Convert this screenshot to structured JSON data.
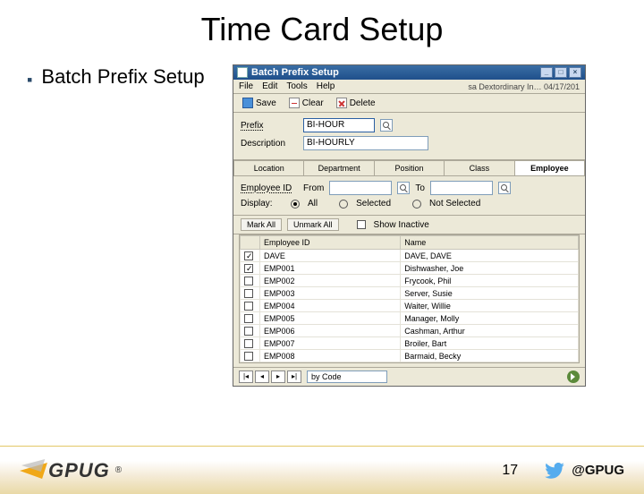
{
  "slide": {
    "title": "Time Card Setup",
    "bullet": "Batch Prefix Setup",
    "page_number": "17",
    "logo_text": "GPUG",
    "logo_reg": "®",
    "twitter_handle": "@GPUG"
  },
  "window": {
    "title": "Batch Prefix Setup",
    "status_user": "sa  Dextordinary In…  04/17/201",
    "menu": {
      "file": "File",
      "edit": "Edit",
      "tools": "Tools",
      "help": "Help"
    },
    "toolbar": {
      "save": "Save",
      "clear": "Clear",
      "delete": "Delete"
    },
    "form": {
      "prefix_label": "Prefix",
      "prefix_value": "BI-HOUR",
      "description_label": "Description",
      "description_value": "BI-HOURLY"
    },
    "tabs": {
      "location": "Location",
      "department": "Department",
      "position": "Position",
      "class": "Class",
      "employee": "Employee"
    },
    "filter": {
      "employee_id_label": "Employee ID",
      "from_label": "From",
      "to_label": "To",
      "display_label": "Display:",
      "all": "All",
      "selected": "Selected",
      "not_selected": "Not Selected"
    },
    "grid_toolbar": {
      "mark_all": "Mark All",
      "unmark_all": "Unmark All",
      "show_inactive": "Show Inactive"
    },
    "grid": {
      "col_employee": "Employee ID",
      "col_name": "Name",
      "rows": [
        {
          "checked": true,
          "id": "DAVE",
          "name": "DAVE, DAVE"
        },
        {
          "checked": true,
          "id": "EMP001",
          "name": "Dishwasher, Joe"
        },
        {
          "checked": false,
          "id": "EMP002",
          "name": "Frycook, Phil"
        },
        {
          "checked": false,
          "id": "EMP003",
          "name": "Server, Susie"
        },
        {
          "checked": false,
          "id": "EMP004",
          "name": "Waiter, Willie"
        },
        {
          "checked": false,
          "id": "EMP005",
          "name": "Manager, Molly"
        },
        {
          "checked": false,
          "id": "EMP006",
          "name": "Cashman, Arthur"
        },
        {
          "checked": false,
          "id": "EMP007",
          "name": "Broiler, Bart"
        },
        {
          "checked": false,
          "id": "EMP008",
          "name": "Barmaid, Becky"
        }
      ]
    },
    "footer": {
      "sort": "by Code"
    }
  }
}
